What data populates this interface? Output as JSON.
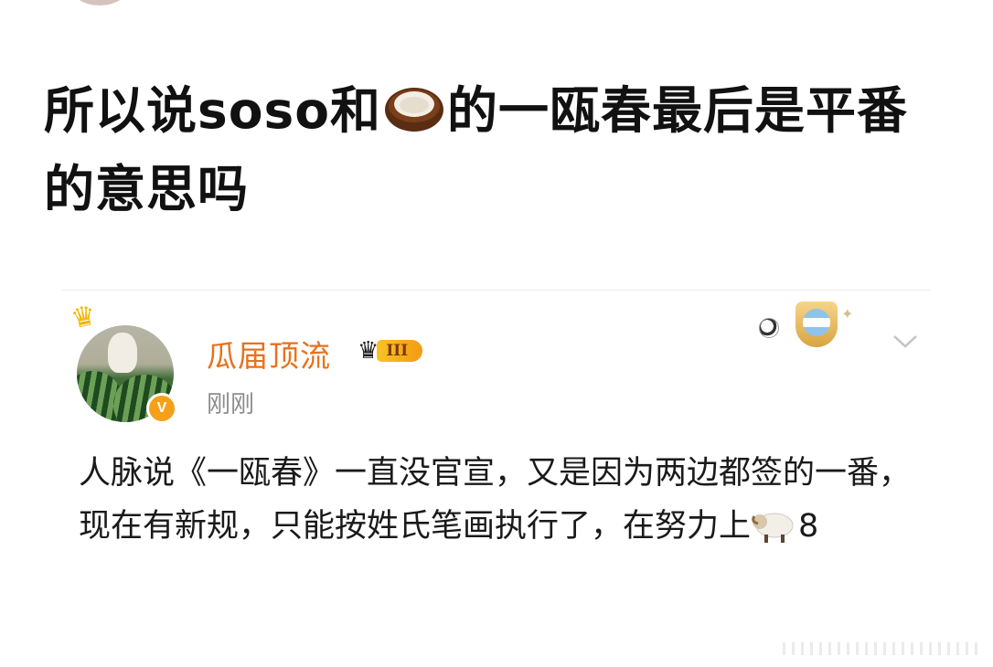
{
  "post": {
    "title_part1": "所以说soso和",
    "title_emoji": "coconut-emoji",
    "title_part2": "的一瓯春最后是平番的意思吗"
  },
  "comment": {
    "username": "瓜届顶流",
    "level_badge": "III",
    "verified_mark": "V",
    "timestamp": "刚刚",
    "text_part1": "人脉说《一瓯春》一直没官宣，又是因为两边都签的一番，现在有新规，只能按姓氏笔画执行了，在努力上",
    "text_emoji": "sheep-emoji",
    "text_part2": "8",
    "decor_icons": [
      "soccer-ball-icon",
      "argentina-shield-icon"
    ],
    "menu_icon": "chevron-down-icon"
  },
  "colors": {
    "username": "#e9711c",
    "timestamp": "#8c8c8c",
    "badge_gold": "#f39b12"
  }
}
